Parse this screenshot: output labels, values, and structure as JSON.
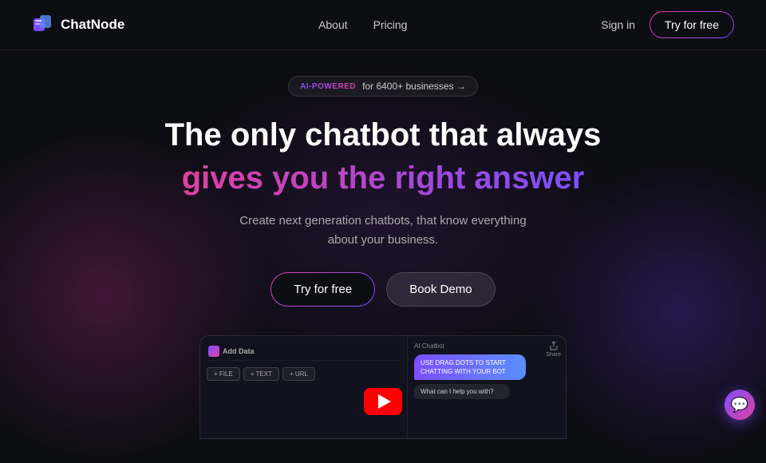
{
  "brand": {
    "name": "ChatNode",
    "logo_alt": "ChatNode Logo"
  },
  "nav": {
    "links": [
      {
        "label": "About",
        "id": "about"
      },
      {
        "label": "Pricing",
        "id": "pricing"
      }
    ],
    "sign_in": "Sign in",
    "try_free": "Try for free"
  },
  "hero": {
    "badge_label": "AI-POWERED",
    "badge_text": "for 6400+ businesses →",
    "title_line1": "The only chatbot that always",
    "title_line2": "gives you the right answer",
    "subtitle": "Create next generation chatbots, that know everything about your business.",
    "btn_try_free": "Try for free",
    "btn_book_demo": "Book Demo"
  },
  "dashboard": {
    "logo_title": "Add Data",
    "btn_file": "+ FILE",
    "btn_text": "+ TEXT",
    "btn_url": "+ URL",
    "chatbot_label": "AI Chatbot",
    "share_label": "Share",
    "chat_user_msg": "USE DRAG DOTS TO START CHATTING WITH YOUR BOT",
    "chat_bot_msg": "What can I help you with?"
  },
  "youtube": {
    "label": "Play video"
  },
  "chat_widget": {
    "label": "Open chat"
  }
}
